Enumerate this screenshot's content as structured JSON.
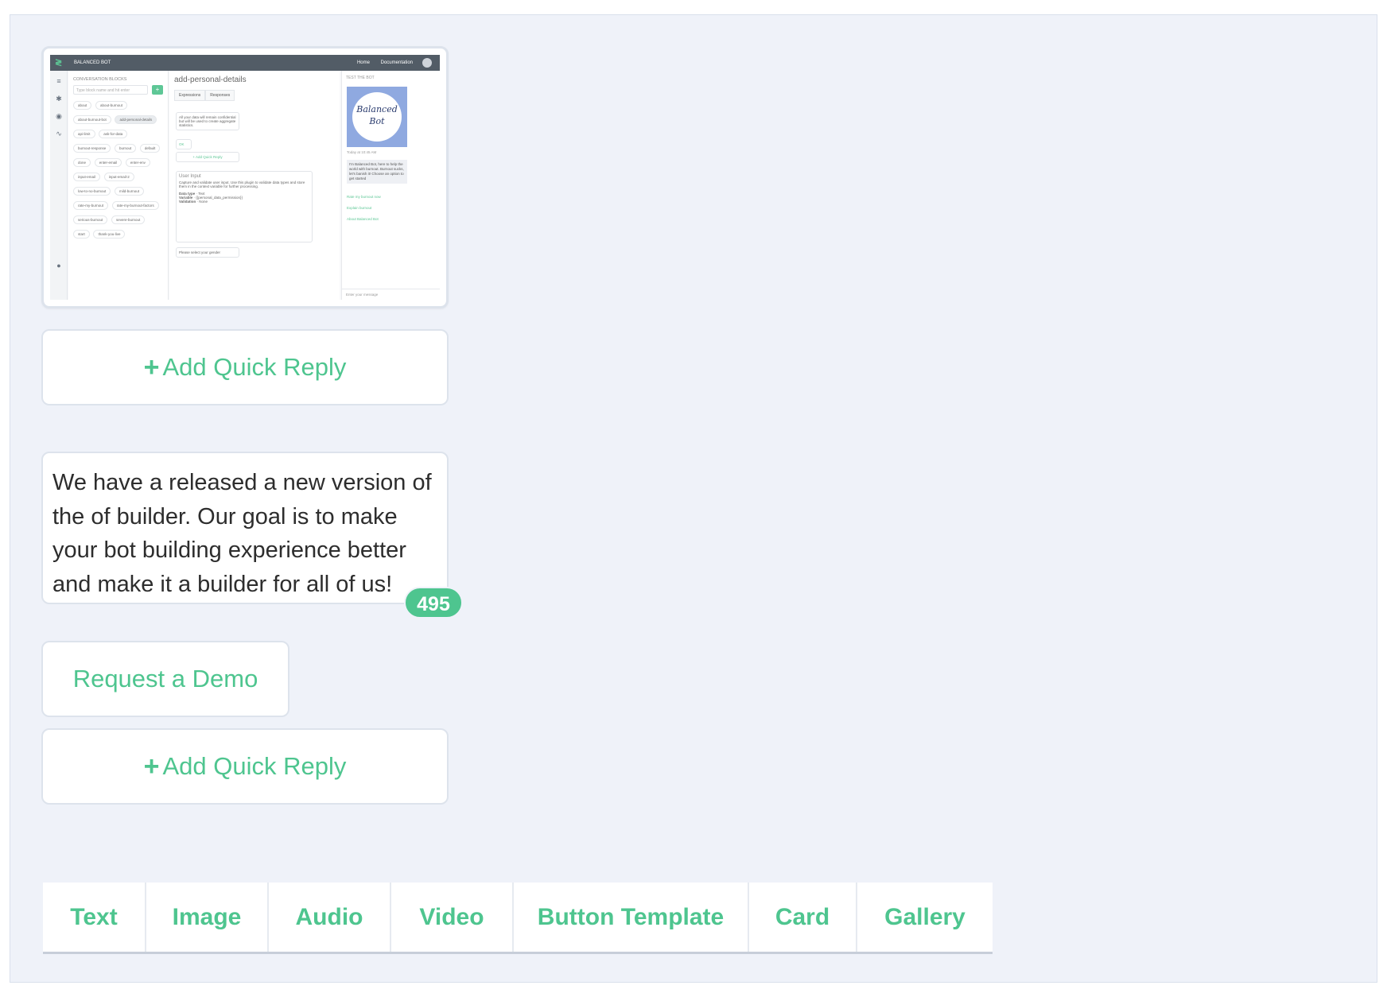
{
  "thumbnail": {
    "brand": "BALANCED BOT",
    "nav_links": [
      "Home",
      "Documentation"
    ],
    "blocks_header": "CONVERSATION BLOCKS",
    "search_placeholder": "Type block name and hit enter",
    "chips": [
      "about",
      "about-burnout",
      "about-burnout-bot",
      "add-personal-details",
      "api-limit",
      "ask-for-data",
      "burnout-response",
      "burnout",
      "default",
      "done",
      "enter-email",
      "enter-env",
      "input-email",
      "input-email-2",
      "low-to-no-burnout",
      "mild-burnout",
      "rate-my-burnout",
      "rate-my-burnout-factors",
      "serious-burnout",
      "severe-burnout",
      "start",
      "thank-you-live"
    ],
    "selected_chip": "add-personal-details",
    "block_title": "add-personal-details",
    "tabs": [
      "Expressions",
      "Responses"
    ],
    "notice_text": "All your data will remain confidential but will be used to create aggregate statistics.",
    "ok_label": "OK",
    "add_quick_reply": "+ Add Quick Reply",
    "user_input_title": "User Input",
    "user_input_desc": "Capture and validate user input. Use this plugin to validate data types and store them in the context variable for further processing.",
    "data_type_label": "Data type",
    "data_type_value": "Text",
    "variable_label": "Variable",
    "variable_value": "{{personal_data_permission}}",
    "validation_label": "Validation",
    "validation_value": "None",
    "gender_prompt": "Please select your gender",
    "chat_header": "TEST THE BOT",
    "logo_line1": "Balanced",
    "logo_line2": "Bot",
    "timestamp": "Today at 10:45 AM",
    "bot_message": "I'm Balanced Bot, here to help the world with burnout. Burnout sucks, let's banish it! Choose an option to get started",
    "quick_replies": [
      "Rate my burnout now",
      "Explain burnout",
      "About Balanced Bot"
    ],
    "chat_input_placeholder": "Enter your message"
  },
  "quick_reply_button": {
    "icon": "+",
    "label": "Add Quick Reply"
  },
  "text_card": {
    "lines": [
      "We have a released a new version of",
      "the of builder.  Our goal is to make",
      "your bot building experience better",
      "and make it a builder for all of us!"
    ],
    "counter": "495"
  },
  "demo_button": {
    "label": "Request a Demo"
  },
  "tab_bar": {
    "tabs": [
      "Text",
      "Image",
      "Audio",
      "Video",
      "Button Template",
      "Card",
      "Gallery"
    ]
  },
  "colors": {
    "accent": "#4ec58f",
    "background": "#eff2f9",
    "text": "#2d2d2d"
  }
}
